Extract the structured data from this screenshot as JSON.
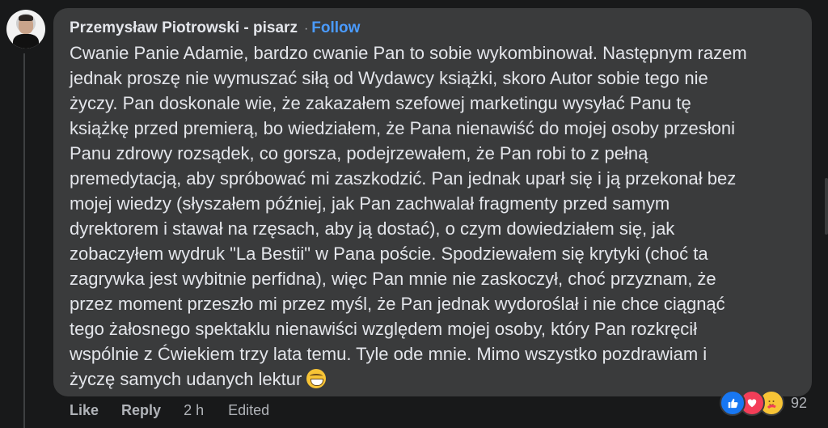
{
  "comment": {
    "author": "Przemysław Piotrowski - pisarz",
    "separator": "·",
    "follow_label": "Follow",
    "text_lines": [
      "Cwanie Panie Adamie, bardzo cwanie Pan to sobie wykombinował. Następnym razem",
      "jednak proszę nie wymuszać siłą od Wydawcy książki, skoro Autor sobie tego nie",
      "życzy. Pan doskonale wie, że zakazałem szefowej marketingu wysyłać Panu tę",
      "książkę przed premierą, bo wiedziałem, że Pana nienawiść do mojej osoby przesłoni",
      "Panu zdrowy rozsądek, co gorsza, podejrzewałem, że Pan robi to z pełną",
      "premedytacją, aby spróbować mi zaszkodzić. Pan jednak uparł się i ją przekonał bez",
      "mojej wiedzy (słyszałem później, jak Pan zachwalał fragmenty przed samym",
      "dyrektorem i stawał na rzęsach, aby ją dostać), o czym dowiedziałem się, jak",
      "zobaczyłem wydruk \"La Bestii\" w Pana poście. Spodziewałem się krytyki (choć ta",
      "zagrywka jest wybitnie perfidna), więc Pan mnie nie zaskoczył, choć przyznam, że",
      "przez moment przeszło mi przez myśl, że Pan jednak wydoroślał i nie chce ciągnąć",
      "tego żałosnego spektaklu nienawiści względem mojej osoby, który Pan rozkręcił",
      "wspólnie z Ćwiekiem trzy lata temu. Tyle ode mnie. Mimo wszystko pozdrawiam i",
      "życzę samych udanych lektur"
    ],
    "end_emoji": "grinning-face-with-smiling-eyes"
  },
  "actions": {
    "like_label": "Like",
    "reply_label": "Reply",
    "time": "2 h",
    "edited_label": "Edited"
  },
  "reactions": {
    "types": [
      "like",
      "love",
      "care"
    ],
    "count": "92"
  },
  "colors": {
    "background": "#18191a",
    "bubble": "#3a3b3c",
    "text": "#e4e6eb",
    "muted": "#b0b3b8",
    "accent": "#4a9bff"
  }
}
